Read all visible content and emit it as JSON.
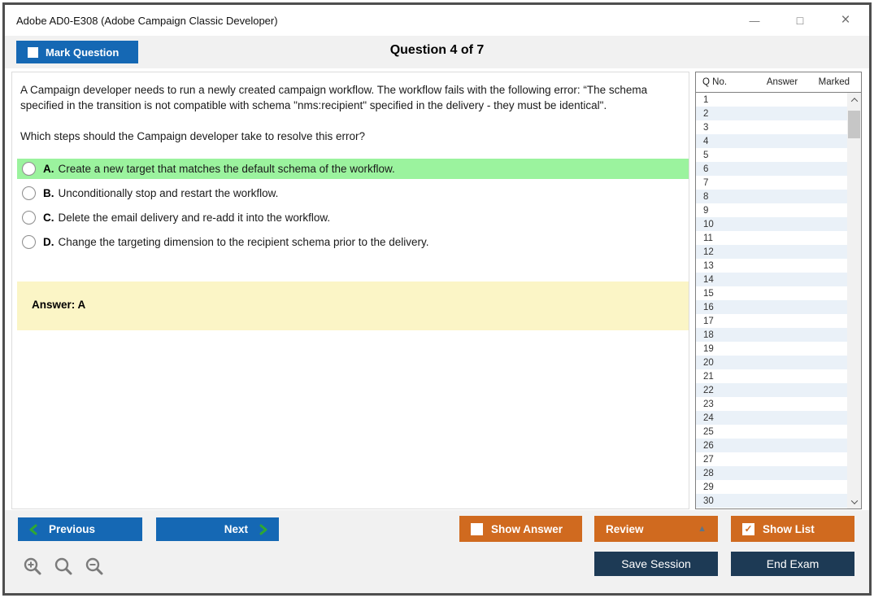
{
  "window": {
    "title": "Adobe AD0-E308 (Adobe Campaign Classic Developer)",
    "controls": [
      {
        "name": "minimize",
        "glyph": "—"
      },
      {
        "name": "maximize",
        "glyph": "□"
      },
      {
        "name": "close",
        "glyph": "×"
      }
    ]
  },
  "header": {
    "mark_question_label": "Mark Question",
    "question_counter": "Question 4 of 7"
  },
  "question": {
    "paragraphs": [
      "A Campaign developer needs to run a newly created campaign workflow. The workflow fails with the following error: “The schema specified in the transition is not compatible with schema \"nms:recipient\" specified in the delivery - they must be identical\".",
      "Which steps should the Campaign developer take to resolve this error?"
    ],
    "options": [
      {
        "letter": "A.",
        "text": "Create a new target that matches the default schema of the workflow.",
        "highlighted": true
      },
      {
        "letter": "B.",
        "text": "Unconditionally stop and restart the workflow.",
        "highlighted": false
      },
      {
        "letter": "C.",
        "text": "Delete the email delivery and re-add it into the workflow.",
        "highlighted": false
      },
      {
        "letter": "D.",
        "text": "Change the targeting dimension to the recipient schema prior to the delivery.",
        "highlighted": false
      }
    ],
    "answer": "Answer: A"
  },
  "question_list": {
    "columns": [
      "Q No.",
      "Answer",
      "Marked"
    ],
    "rows": [
      "1",
      "2",
      "3",
      "4",
      "5",
      "6",
      "7",
      "8",
      "9",
      "10",
      "11",
      "12",
      "13",
      "14",
      "15",
      "16",
      "17",
      "18",
      "19",
      "20",
      "21",
      "22",
      "23",
      "24",
      "25",
      "26",
      "27",
      "28",
      "29",
      "30"
    ]
  },
  "footer": {
    "previous_label": "Previous",
    "next_label": "Next",
    "show_answer_label": "Show Answer",
    "review_label": "Review",
    "show_list_label": "Show List",
    "save_session_label": "Save Session",
    "end_exam_label": "End Exam",
    "review_caret": "▲",
    "show_list_check": "✓"
  },
  "colors": {
    "blue_button": "#1568b4",
    "orange_button": "#d06a1f",
    "navy_button": "#1d3a55",
    "highlight_green": "#9bf39e",
    "answer_yellow": "#fbf5c6",
    "alt_row_blue": "#eaf1f8",
    "strip_gray": "#f1f1f1"
  }
}
